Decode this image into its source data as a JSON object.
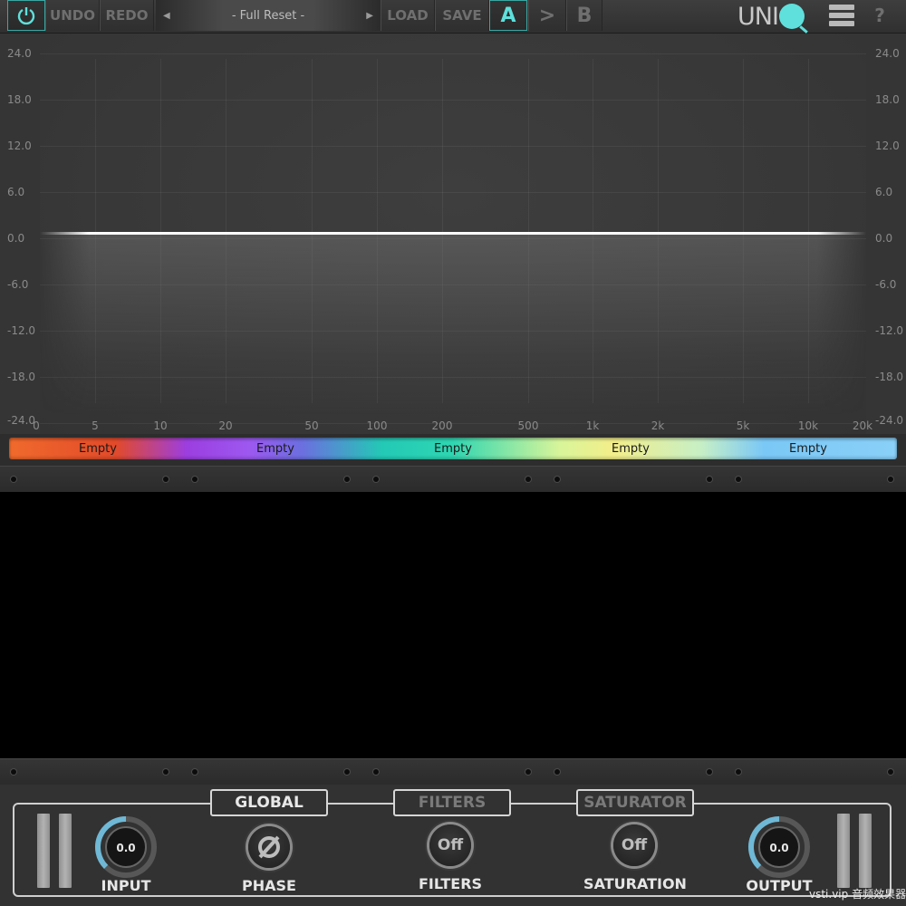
{
  "toolbar": {
    "undo_label": "UNDO",
    "redo_label": "REDO",
    "preset_name": "- Full Reset -",
    "load_label": "LOAD",
    "save_label": "SAVE",
    "a_label": "A",
    "copy_label": ">",
    "b_label": "B",
    "logo_text": "UNI",
    "help_label": "?"
  },
  "eq": {
    "y_labels_left": [
      "24.0",
      "18.0",
      "12.0",
      "6.0",
      "0.0",
      "-6.0",
      "-12.0",
      "-18.0",
      "-24.0"
    ],
    "y_labels_right": [
      "24.0",
      "18.0",
      "12.0",
      "6.0",
      "0.0",
      "-6.0",
      "-12.0",
      "-18.0",
      "-24.0"
    ],
    "x_labels": [
      "0",
      "5",
      "10",
      "20",
      "50",
      "100",
      "200",
      "500",
      "1k",
      "2k",
      "5k",
      "10k",
      "20k"
    ]
  },
  "bands": [
    {
      "label": "Empty"
    },
    {
      "label": "Empty"
    },
    {
      "label": "Empty"
    },
    {
      "label": "Empty"
    },
    {
      "label": "Empty"
    }
  ],
  "sections": {
    "global": "GLOBAL",
    "filters": "FILTERS",
    "saturator": "SATURATOR"
  },
  "controls": {
    "input": {
      "label": "INPUT",
      "value": "0.0",
      "level": 0.5
    },
    "phase": {
      "label": "PHASE"
    },
    "filters": {
      "label": "FILTERS",
      "state": "Off"
    },
    "saturation": {
      "label": "SATURATION",
      "state": "Off"
    },
    "output": {
      "label": "OUTPUT",
      "value": "0.0",
      "level": 0.5
    }
  },
  "watermark": "vsti.vip 音频效果器",
  "colors": {
    "accent": "#5ee0dc",
    "knob_arc": "#6fb8d6"
  }
}
